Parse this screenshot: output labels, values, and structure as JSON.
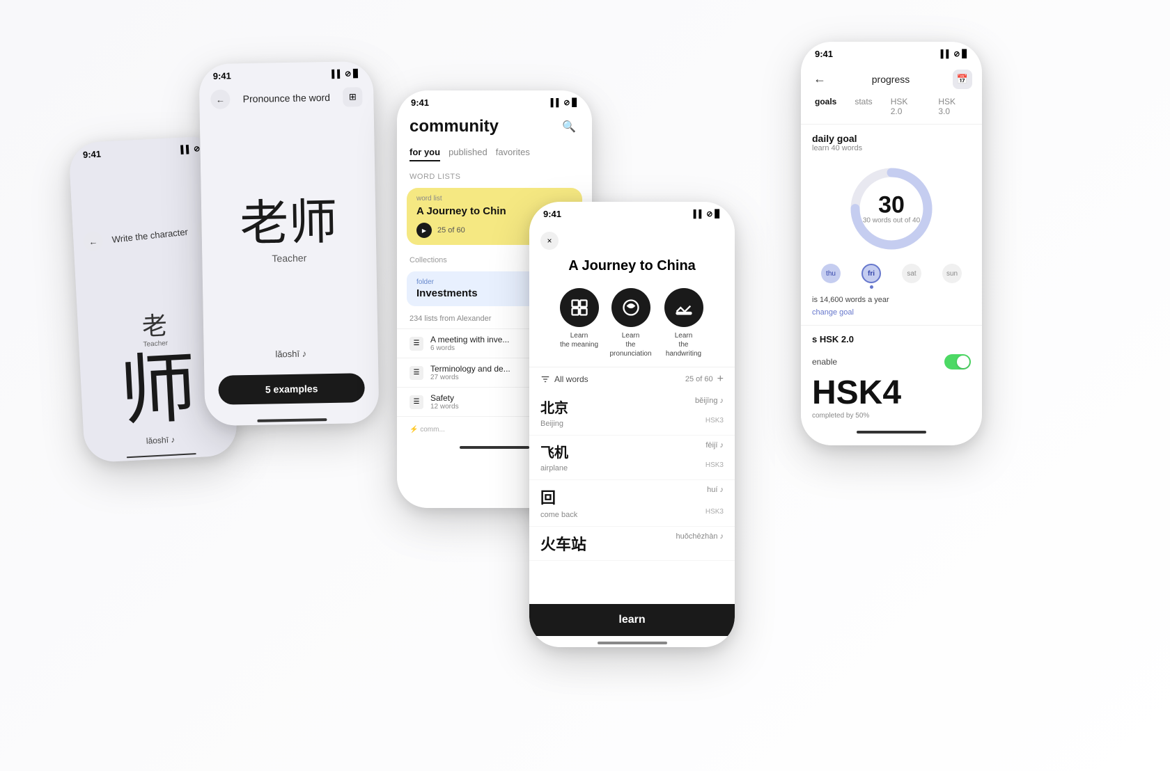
{
  "phone1": {
    "status_time": "9:41",
    "title": "Write the character",
    "char_small": "老",
    "char_label_small": "Teacher",
    "char_large": "师",
    "pinyin": "lǎoshī ♪"
  },
  "phone2": {
    "status_time": "9:41",
    "title": "Pronounce the word",
    "char_big": "老师",
    "char_label": "Teacher",
    "pinyin": "lǎoshī ♪",
    "examples_btn": "5 examples"
  },
  "phone3": {
    "status_time": "9:41",
    "title": "community",
    "tabs": [
      "for you",
      "published",
      "favorites"
    ],
    "active_tab": "for you",
    "search_icon": "🔍",
    "word_lists_label": "Word lists",
    "word_list_label": "word list",
    "word_list_title": "A Journey to Chin",
    "progress": "25 of 60",
    "collections_label": "Collections",
    "folder_label": "folder",
    "folder_title": "Investments",
    "lists_from": "234 lists from Alexander",
    "list_items": [
      {
        "name": "A meeting with inve...",
        "count": "6 words"
      },
      {
        "name": "Terminology and de...",
        "count": "27 words"
      },
      {
        "name": "Safety",
        "count": "12 words"
      }
    ]
  },
  "phone4": {
    "status_time": "9:41",
    "modal_title": "A Journey to China",
    "close_label": "×",
    "learn_items": [
      {
        "icon": "🔤",
        "label": "Learn\nthe meaning"
      },
      {
        "icon": "🔊",
        "label": "Learn\nthe pronunciation"
      },
      {
        "icon": "✍️",
        "label": "Learn\nthe handwriting"
      }
    ],
    "filter_label": "All words",
    "filter_count": "25 of 60",
    "vocab": [
      {
        "chinese": "北京",
        "english": "Beijing",
        "pinyin": "běijīng ♪",
        "hsk": "HSK3"
      },
      {
        "chinese": "飞机",
        "english": "airplane",
        "pinyin": "fēijī ♪",
        "hsk": "HSK3"
      },
      {
        "chinese": "回",
        "english": "come back",
        "pinyin": "huí ♪",
        "hsk": "HSK3"
      },
      {
        "chinese": "火车站",
        "english": "",
        "pinyin": "huǒchēzhàn ♪",
        "hsk": ""
      }
    ],
    "learn_btn": "learn"
  },
  "phone5": {
    "status_time": "9:41",
    "back_icon": "←",
    "title": "progress",
    "tabs": [
      "goals",
      "stats",
      "HSK 2.0",
      "HSK 3.0"
    ],
    "active_tab": "goals",
    "daily_goal_title": "daily goal",
    "daily_goal_sub": "learn 40 words",
    "donut_value": 30,
    "donut_label": "30 words out of 40",
    "days": [
      {
        "label": "thu",
        "active": true,
        "has_dot": false
      },
      {
        "label": "fri",
        "active": true,
        "is_current": true,
        "has_dot": true
      },
      {
        "label": "sat",
        "active": false,
        "has_dot": false
      },
      {
        "label": "sun",
        "active": false,
        "has_dot": false
      }
    ],
    "stats_text": "is 14,600 words a year",
    "change_goal": "change goal",
    "hsk_section_title": "s HSK 2.0",
    "hsk4_label": "HSK4",
    "hsk4_sub": "completed by 50%",
    "calendar_icon": "📅"
  },
  "colors": {
    "accent_blue": "#c5cdf0",
    "accent_dark": "#1a1a1a",
    "accent_yellow": "#f5e882",
    "accent_green": "#4cd964",
    "toggle_bg": "#4cd964"
  }
}
